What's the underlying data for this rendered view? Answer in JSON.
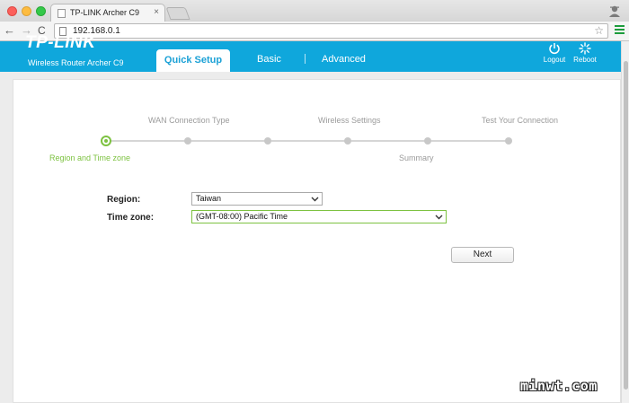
{
  "browser": {
    "tab_title": "TP-LINK Archer C9",
    "tab_close": "×",
    "url": "192.168.0.1",
    "nav_back": "←",
    "nav_forward": "→",
    "nav_reload": "C",
    "star": "☆"
  },
  "router": {
    "logo": "TP-LINK",
    "model": "Wireless Router Archer C9",
    "tabs": {
      "quick_setup": "Quick Setup",
      "basic": "Basic",
      "advanced": "Advanced"
    },
    "logout_label": "Logout",
    "reboot_label": "Reboot",
    "accent": "#0fa7dc"
  },
  "wizard": {
    "steps_top": {
      "wan": "WAN Connection Type",
      "wireless": "Wireless Settings",
      "test": "Test Your Connection"
    },
    "steps_bottom": {
      "region": "Region and Time zone",
      "summary": "Summary"
    },
    "active_color": "#7dc241"
  },
  "form": {
    "region_label": "Region:",
    "region_value": "Taiwan",
    "timezone_label": "Time zone:",
    "timezone_value": "(GMT-08:00) Pacific Time",
    "next_label": "Next"
  },
  "watermark": "minwt.com"
}
